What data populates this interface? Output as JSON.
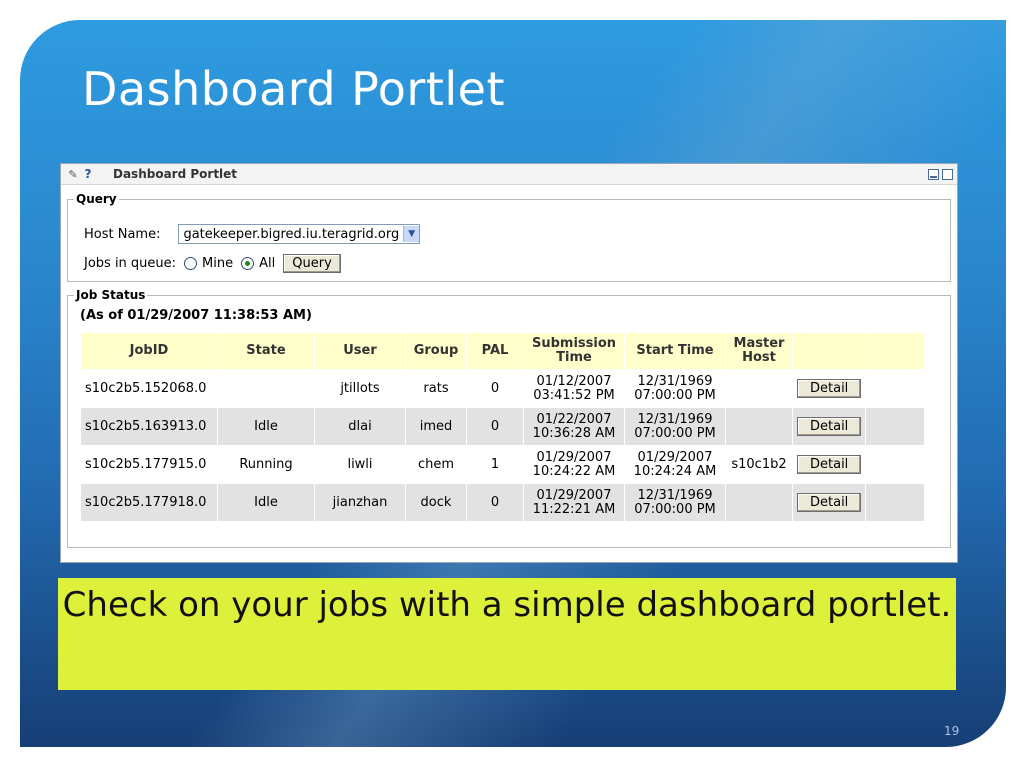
{
  "slide": {
    "title": "Dashboard Portlet",
    "caption": "Check on your jobs with a simple dashboard portlet.",
    "page_number": "19"
  },
  "portlet": {
    "header": {
      "edit_icon": "pencil-icon",
      "help_label": "?",
      "title": "Dashboard Portlet",
      "minimize_icon": "minimize-icon",
      "maximize_icon": "maximize-icon"
    },
    "query": {
      "legend": "Query",
      "host_label": "Host Name:",
      "host_value": "gatekeeper.bigred.iu.teragrid.org",
      "jobs_label": "Jobs in queue:",
      "option_mine": "Mine",
      "option_all": "All",
      "selected_option": "All",
      "query_button": "Query"
    },
    "job_status": {
      "legend": "Job Status",
      "as_of": "(As of 01/29/2007 11:38:53 AM)",
      "columns": {
        "jobid": "JobID",
        "state": "State",
        "user": "User",
        "group": "Group",
        "pal": "PAL",
        "submission_1": "Submission",
        "submission_2": "Time",
        "start_time": "Start Time",
        "master_1": "Master",
        "master_2": "Host"
      },
      "detail_label": "Detail",
      "rows": [
        {
          "jobid": "s10c2b5.152068.0",
          "state": "",
          "user": "jtillots",
          "group": "rats",
          "pal": "0",
          "sub_date": "01/12/2007",
          "sub_time": "03:41:52 PM",
          "start_date": "12/31/1969",
          "start_time": "07:00:00 PM",
          "master": ""
        },
        {
          "jobid": "s10c2b5.163913.0",
          "state": "Idle",
          "user": "dlai",
          "group": "imed",
          "pal": "0",
          "sub_date": "01/22/2007",
          "sub_time": "10:36:28 AM",
          "start_date": "12/31/1969",
          "start_time": "07:00:00 PM",
          "master": ""
        },
        {
          "jobid": "s10c2b5.177915.0",
          "state": "Running",
          "user": "liwli",
          "group": "chem",
          "pal": "1",
          "sub_date": "01/29/2007",
          "sub_time": "10:24:22 AM",
          "start_date": "01/29/2007",
          "start_time": "10:24:24 AM",
          "master": "s10c1b2"
        },
        {
          "jobid": "s10c2b5.177918.0",
          "state": "Idle",
          "user": "jianzhan",
          "group": "dock",
          "pal": "0",
          "sub_date": "01/29/2007",
          "sub_time": "11:22:21 AM",
          "start_date": "12/31/1969",
          "start_time": "07:00:00 PM",
          "master": ""
        }
      ]
    }
  },
  "colors": {
    "slide_blue": "#2a86cc",
    "caption_bg": "#ddf03a",
    "table_header_bg": "#ffffcc",
    "alt_row_bg": "#e2e2e2"
  }
}
